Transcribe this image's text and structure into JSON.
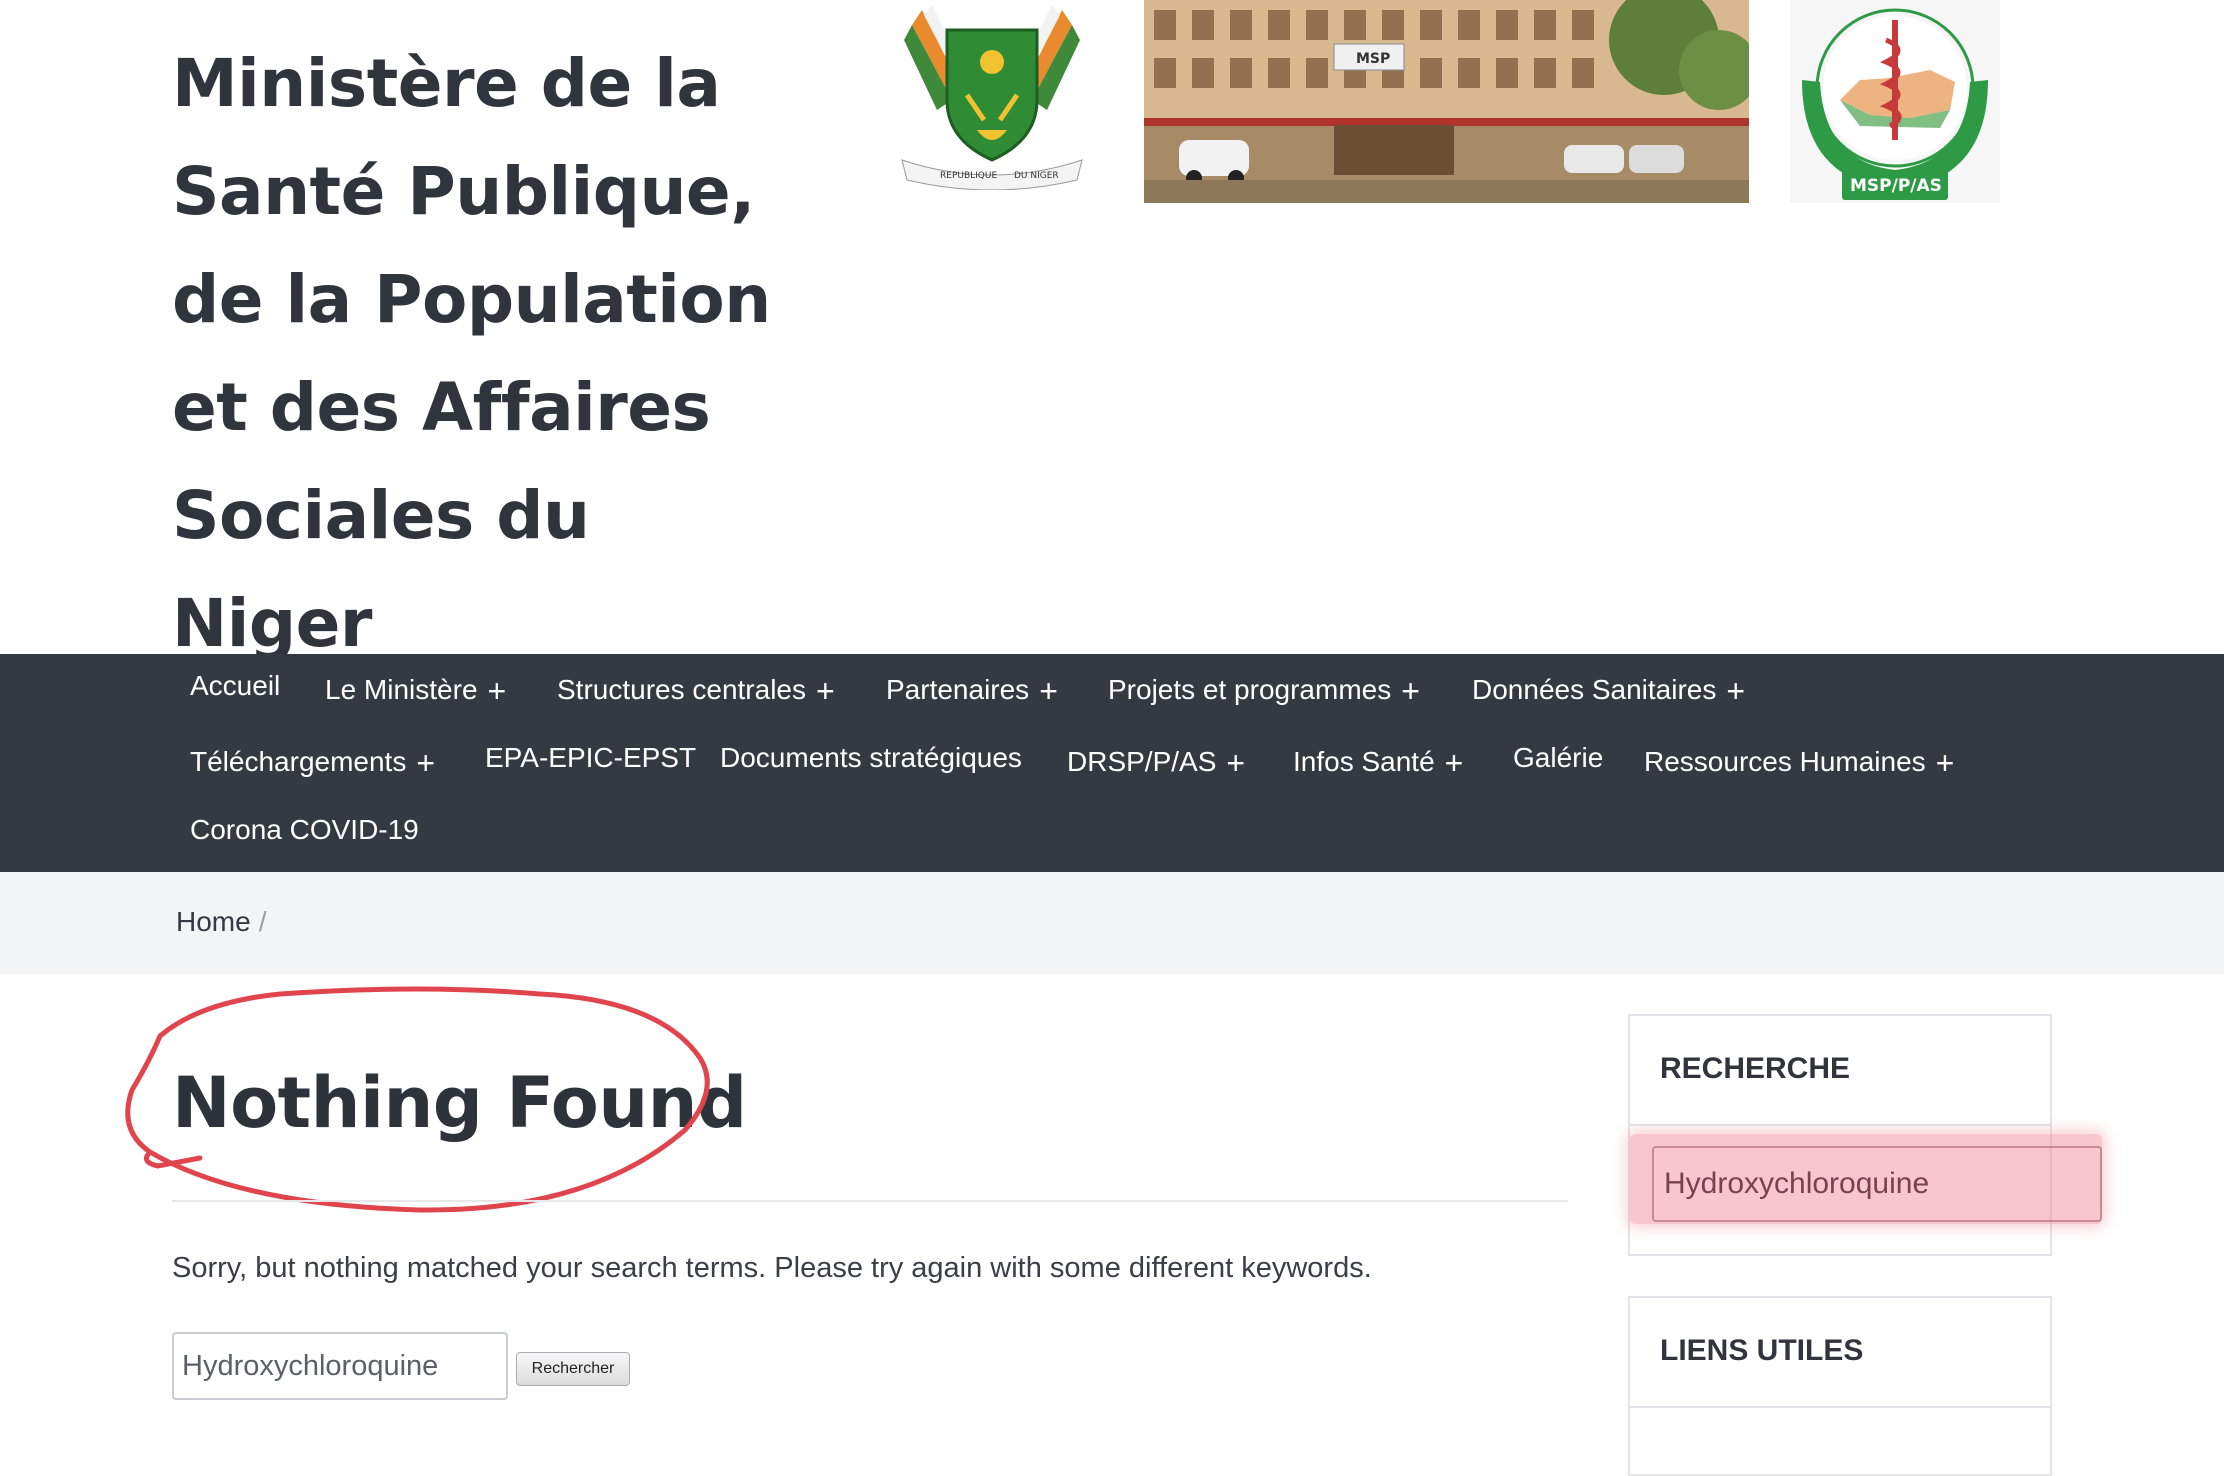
{
  "header": {
    "site_title_lines": [
      "Ministère de la",
      "Santé Publique,",
      "de la Population",
      "et des Affaires",
      "Sociales du Niger"
    ],
    "coat_of_arms_caption": [
      "REPUBLIQUE",
      "DU NIGER"
    ],
    "msp_logo_caption": "MSP/P/AS",
    "building_sign": "MSP"
  },
  "nav": {
    "items": [
      {
        "label": "Accueil",
        "has_submenu": false
      },
      {
        "label": "Le Ministère",
        "has_submenu": true
      },
      {
        "label": "Structures centrales",
        "has_submenu": true
      },
      {
        "label": "Partenaires",
        "has_submenu": true
      },
      {
        "label": "Projets et programmes",
        "has_submenu": true
      },
      {
        "label": "Données Sanitaires",
        "has_submenu": true
      },
      {
        "label": "Téléchargements",
        "has_submenu": true
      },
      {
        "label": "EPA-EPIC-EPST",
        "has_submenu": false
      },
      {
        "label": "Documents stratégiques",
        "has_submenu": false
      },
      {
        "label": "DRSP/P/AS",
        "has_submenu": true
      },
      {
        "label": "Infos Santé",
        "has_submenu": true
      },
      {
        "label": "Galérie",
        "has_submenu": false
      },
      {
        "label": "Ressources Humaines",
        "has_submenu": true
      },
      {
        "label": "Corona COVID-19",
        "has_submenu": false
      }
    ],
    "submenu_symbol": "+"
  },
  "breadcrumb": {
    "home": "Home",
    "separator": "/"
  },
  "main": {
    "title": "Nothing Found",
    "message": "Sorry, but nothing matched your search terms. Please try again with some different keywords.",
    "search_value": "Hydroxychloroquine",
    "search_button": "Rechercher"
  },
  "sidebar": {
    "search_title": "RECHERCHE",
    "search_value": "Hydroxychloroquine",
    "links_title": "LIENS UTILES"
  },
  "colors": {
    "nav_background": "#353a42",
    "breadcrumb_background": "#f3f4f5",
    "annotation_red": "#e0454e",
    "highlight_pink": "#ec788c"
  }
}
